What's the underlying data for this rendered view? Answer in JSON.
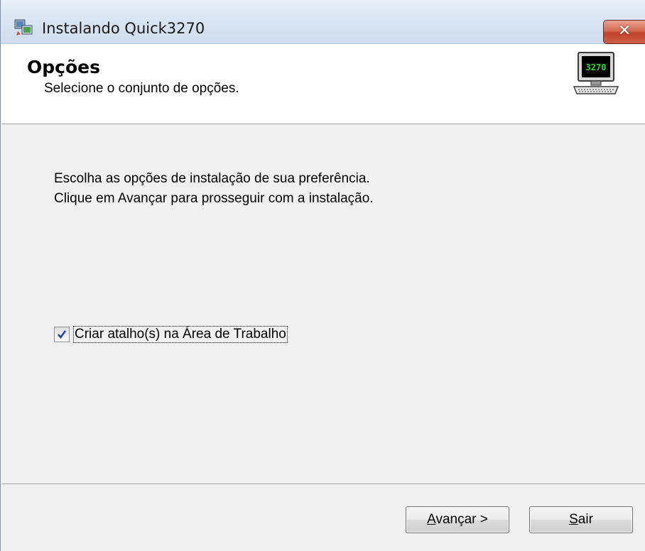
{
  "window": {
    "title": "Instalando Quick3270",
    "close_symbol": "✕",
    "icon": "installer-icon"
  },
  "header": {
    "title": "Opções",
    "subtitle": "Selecione o conjunto de opções.",
    "icon": "terminal-3270-icon",
    "icon_text": "3270"
  },
  "content": {
    "line1": "Escolha as opções de instalação de sua preferência.",
    "line2": "Clique em Avançar para prosseguir com a instalação."
  },
  "options": {
    "create_shortcut": {
      "label": "Criar atalho(s) na Área de Trabalho",
      "checked": true
    }
  },
  "buttons": {
    "next_accel": "A",
    "next_rest": "vançar >",
    "exit_accel": "S",
    "exit_rest": "air"
  }
}
